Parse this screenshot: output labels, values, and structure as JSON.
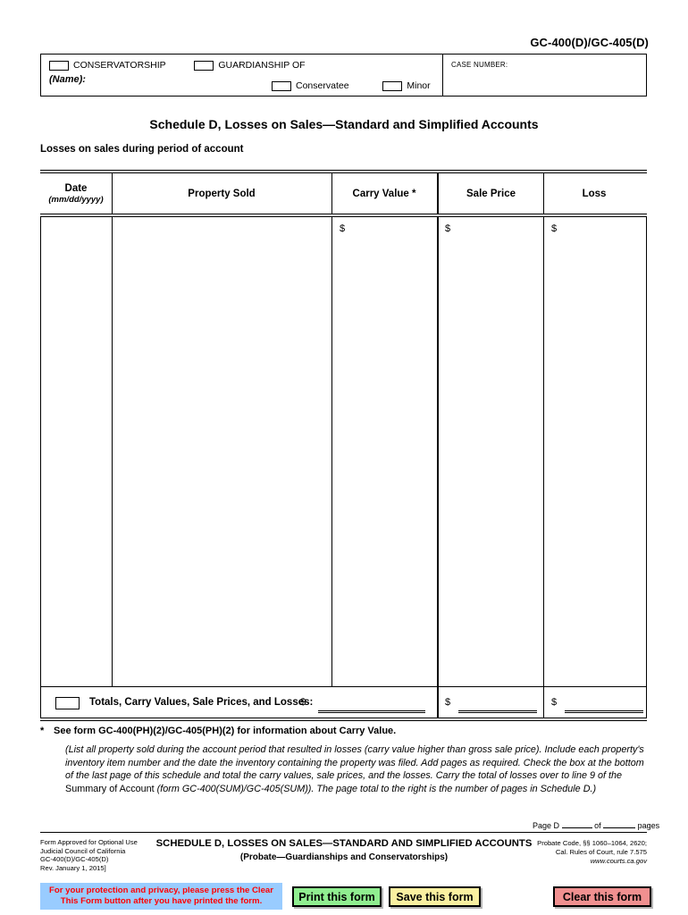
{
  "form": {
    "number": "GC-400(D)/GC-405(D)"
  },
  "caption": {
    "conservatorship_label": "CONSERVATORSHIP",
    "guardianship_label": "GUARDIANSHIP OF",
    "name_label": "(Name):",
    "conservatee_label": "Conservatee",
    "minor_label": "Minor",
    "case_number_label": "CASE NUMBER:"
  },
  "title": "Schedule D, Losses on Sales—Standard and Simplified Accounts",
  "subtitle": "Losses on sales during period of account",
  "table": {
    "headers": {
      "date": "Date",
      "date_sub": "(mm/dd/yyyy)",
      "property": "Property Sold",
      "carry_value": "Carry Value *",
      "sale_price": "Sale Price",
      "loss": "Loss"
    },
    "currency_symbol": "$",
    "rows": []
  },
  "totals": {
    "label": "Totals, Carry Values, Sale Prices, and Losses:",
    "carry_value": "",
    "sale_price": "",
    "loss": ""
  },
  "footnote": {
    "star": "*",
    "text": "See form GC-400(PH)(2)/GC-405(PH)(2) for information about Carry Value."
  },
  "instructions": {
    "part1": "(List all property sold during the account period that resulted in losses (carry value higher than gross sale price). Include each property's inventory item number and the date the inventory containing the property was filed. Add pages as required. Check the box  at the bottom of the last page of this schedule and total the carry values, sale prices, and the losses. Carry the total of losses over to line 9 of the ",
    "roman": "Summary of Account",
    "part2": " (form GC-400(SUM)/GC-405(SUM)). The page total to the right is the number of pages in Schedule D.)"
  },
  "page_line": {
    "prefix": "Page D",
    "value": "",
    "middle": "of",
    "total": "",
    "suffix": "pages"
  },
  "footer": {
    "left": [
      "Form Approved for Optional Use",
      "Judicial Council of California",
      "GC-400(D)/GC-405(D)",
      "Rev. January 1, 2015]"
    ],
    "center_title": "SCHEDULE D, LOSSES ON SALES—STANDARD AND SIMPLIFIED ACCOUNTS",
    "center_subtitle": "(Probate—Guardianships and Conservatorships)",
    "right": [
      "Probate Code, §§ 1060–1064, 2620;",
      "Cal. Rules  of Court, rule 7.575"
    ],
    "url": "www.courts.ca.gov"
  },
  "buttons": {
    "privacy_note": "For your protection and privacy, please press the Clear This Form button after you have printed the form.",
    "print": "Print this form",
    "save": "Save this form",
    "clear": "Clear this form"
  },
  "colors": {
    "privacy_bg": "#99ccff",
    "privacy_text": "#ff0000",
    "print_bg": "#90ee90",
    "save_bg": "#faf0a0",
    "clear_bg": "#f09090",
    "rule": "#000000"
  }
}
